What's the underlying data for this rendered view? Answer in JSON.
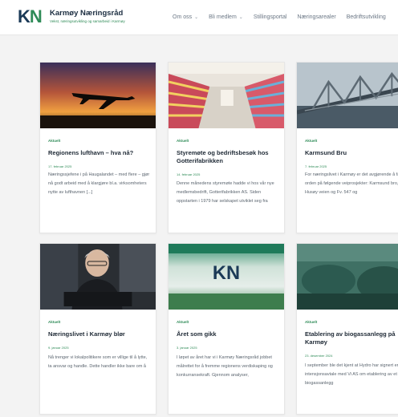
{
  "header": {
    "logo_k": "K",
    "logo_n": "N",
    "brand_name": "Karmøy Næringsråd",
    "brand_tagline": "Vekst, næringsutvikling og samarbeid i Karmøy",
    "nav": [
      {
        "label": "Om oss",
        "has_dropdown": true
      },
      {
        "label": "Bli medlem",
        "has_dropdown": true
      },
      {
        "label": "Stillingsportal",
        "has_dropdown": false
      },
      {
        "label": "Næringsarealer",
        "has_dropdown": false
      },
      {
        "label": "Bedriftsutvikling",
        "has_dropdown": false
      }
    ]
  },
  "colors": {
    "accent_green": "#2e8b57",
    "navy": "#1b3a57",
    "page_bg": "#f3f3f3"
  },
  "posts": [
    {
      "image": "sunset-airplane-photo",
      "category": "Aktuelt",
      "title": "Regionens lufthavn – hva nå?",
      "date": "17. februar 2025",
      "excerpt": "Næringssjefene i på Haugalandet – med flere – gjør nå godt arbeid med å klargjøre bl.a. virksomheters nytte av lufthavnen [...]"
    },
    {
      "image": "candy-store-aisle-photo",
      "category": "Aktuelt",
      "title": "Styremøte og bedriftsbesøk hos Gotterifabrikken",
      "date": "14. februar 2025",
      "excerpt": "Denne månedens styremøte hadde vi hos vår nye medlemsbedrift, Gotterifabrikken AS. Siden oppstarten i 1979 har selskapet utviklet seg fra"
    },
    {
      "image": "bridge-photo",
      "category": "Aktuelt",
      "title": "Karmsund Bru",
      "date": "7. februar 2025",
      "excerpt": "For næringslivet i Karmøy er det avgjørende å få orden på følgende veiprosjekter: Karmsund bro, Husøy veien og Fv. 547 og"
    },
    {
      "image": "man-at-desk-photo",
      "category": "Aktuelt",
      "title": "Næringslivet i Karmøy blør",
      "date": "9. januar 2025",
      "excerpt": "Nå trenger vi lokalpolitikere som er villige til å lytte, ta ansvar og handle. Dette handler ikke bare om å"
    },
    {
      "image": "kn-logo-field-photo",
      "image_text": "KN",
      "category": "Aktuelt",
      "title": "Året som gikk",
      "date": "3. januar 2025",
      "excerpt": "I løpet av året har vi i Karmøy Næringsråd jobbet målrettet for å fremme regionens verdiskaping og konkurransekraft. Gjennom analyser,"
    },
    {
      "image": "biogas-tanks-photo",
      "category": "Aktuelt",
      "title": "Etablering av biogassanlegg på Karmøy",
      "date": "23. desember 2024",
      "excerpt": "I september ble det kjent at Hydro har signert en intensjonsavtale med Vi AS om etablering av et nytt biogassanlegg"
    }
  ]
}
